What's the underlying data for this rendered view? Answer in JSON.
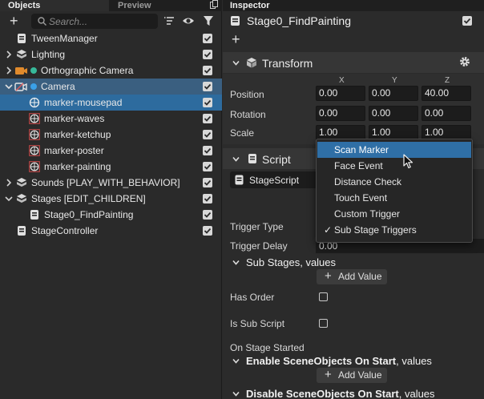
{
  "left_panel": {
    "tabs": {
      "objects": "Objects",
      "preview": "Preview"
    },
    "toolbar": {
      "add_label": "+",
      "search_placeholder": "Search..."
    },
    "tree": [
      {
        "label": "TweenManager",
        "checked": true
      },
      {
        "label": "Lighting",
        "checked": true
      },
      {
        "label": "Orthographic Camera",
        "checked": true
      },
      {
        "label": "Camera",
        "checked": true
      },
      {
        "label": "marker-mousepad",
        "checked": true
      },
      {
        "label": "marker-waves",
        "checked": true
      },
      {
        "label": "marker-ketchup",
        "checked": true
      },
      {
        "label": "marker-poster",
        "checked": true
      },
      {
        "label": "marker-painting",
        "checked": true
      },
      {
        "label": "Sounds [PLAY_WITH_BEHAVIOR]",
        "checked": true
      },
      {
        "label": "Stages [EDIT_CHILDREN]",
        "checked": true
      },
      {
        "label": "Stage0_FindPainting",
        "checked": true
      },
      {
        "label": "StageController",
        "checked": true
      }
    ]
  },
  "inspector": {
    "tab": "Inspector",
    "object_name": "Stage0_FindPainting",
    "add_component": "+",
    "transform": {
      "title": "Transform",
      "axes": [
        "X",
        "Y",
        "Z"
      ],
      "position": {
        "label": "Position",
        "x": "0.00",
        "y": "0.00",
        "z": "40.00"
      },
      "rotation": {
        "label": "Rotation",
        "x": "0.00",
        "y": "0.00",
        "z": "0.00"
      },
      "scale": {
        "label": "Scale",
        "x": "1.00",
        "y": "1.00",
        "z": "1.00"
      }
    },
    "script": {
      "title": "Script",
      "field_label": "StageScript"
    },
    "trigger_type_label": "Trigger Type",
    "trigger_delay": {
      "label": "Trigger Delay",
      "value": "0.00"
    },
    "sub_stages": {
      "title": "Sub Stages",
      "suffix": ", values",
      "add_label": "Add Value"
    },
    "has_order_label": "Has Order",
    "is_sub_script_label": "Is Sub Script",
    "on_stage_started_label": "On Stage Started",
    "enable_objects": {
      "title": "Enable SceneObjects On Start",
      "suffix": ", values",
      "add_label": "Add Value"
    },
    "disable_objects": {
      "title": "Disable SceneObjects On Start",
      "suffix": ", values"
    }
  },
  "dropdown": {
    "items": [
      {
        "label": "Scan Marker",
        "highlighted": true
      },
      {
        "label": "Face Event"
      },
      {
        "label": "Distance Check"
      },
      {
        "label": "Touch Event"
      },
      {
        "label": "Custom Trigger"
      },
      {
        "label": "Sub Stage Triggers",
        "checked": true
      }
    ],
    "check_glyph": "✓"
  },
  "colors": {
    "selection": "#2d6b9e",
    "dropdown_highlight": "#2f6fa6",
    "panel_bg": "#2b2b2b",
    "field_bg": "#1c1c1c"
  }
}
